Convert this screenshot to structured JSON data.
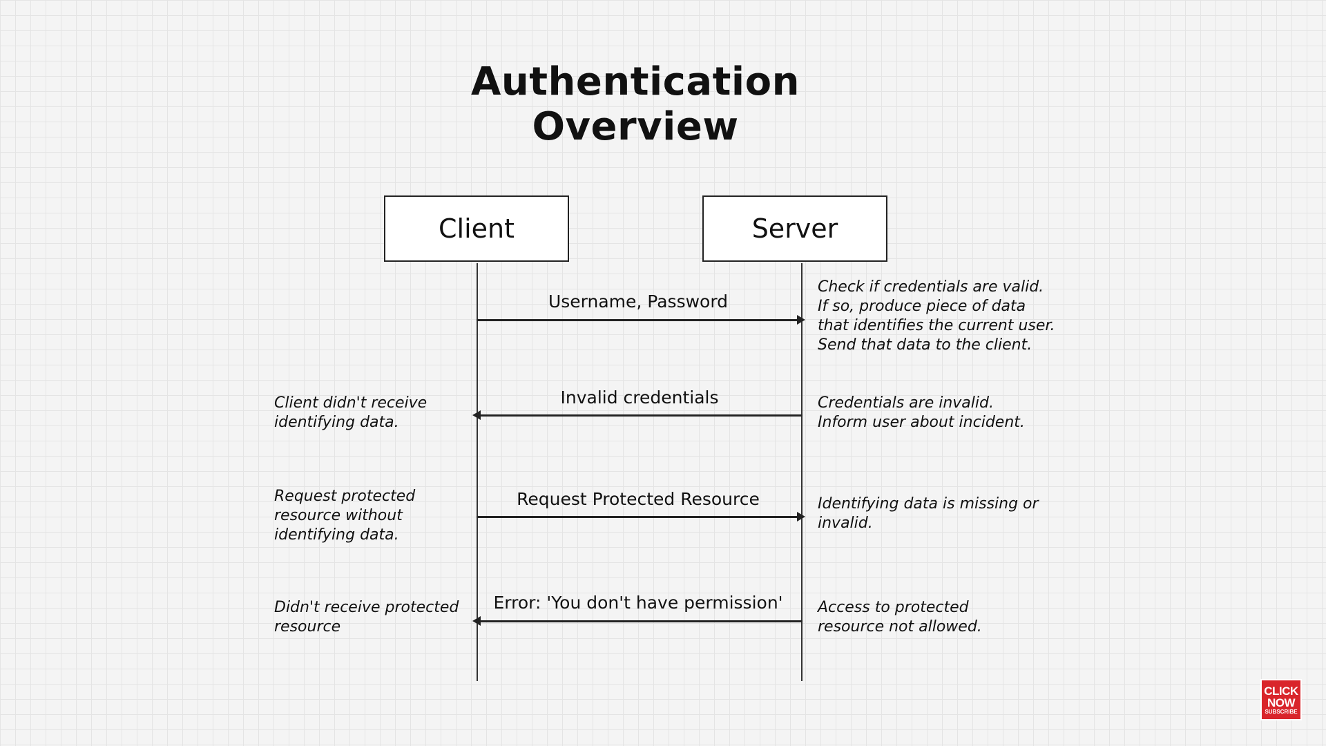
{
  "title": "Authentication Overview",
  "actors": {
    "client": "Client",
    "server": "Server"
  },
  "messages": [
    {
      "label": "Username, Password",
      "direction": "client-to-server"
    },
    {
      "label": "Invalid credentials",
      "direction": "server-to-client"
    },
    {
      "label": "Request Protected Resource",
      "direction": "client-to-server"
    },
    {
      "label": "Error: 'You don't have permission'",
      "direction": "server-to-client"
    }
  ],
  "server_notes": [
    [
      "Check if credentials are valid.",
      "If so, produce piece of data",
      "that identifies the current user.",
      "Send that data to the client."
    ],
    [
      "Credentials are invalid.",
      "Inform user about incident."
    ],
    [
      "Identifying data is missing or",
      "invalid."
    ],
    [
      "Access to protected",
      "resource not allowed."
    ]
  ],
  "client_notes": [
    [
      "Client didn't receive",
      "identifying data."
    ],
    [
      "Request protected",
      "resource without",
      "identifying data."
    ],
    [
      "Didn't receive protected",
      "resource"
    ]
  ],
  "badge": {
    "line1": "CLICK",
    "line2": "NOW",
    "line3": "SUBSCRIBE"
  }
}
